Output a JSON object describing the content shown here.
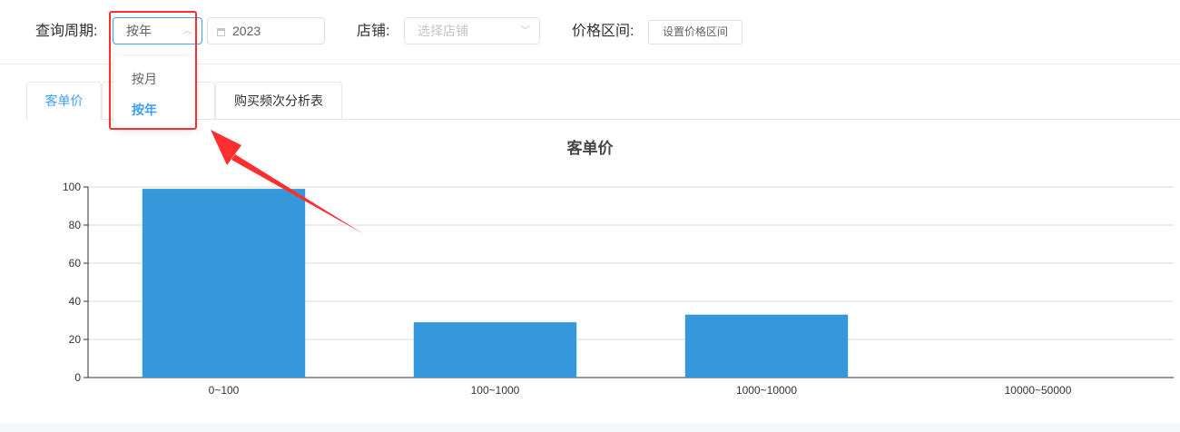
{
  "filter": {
    "period_label": "查询周期:",
    "period_value": "按年",
    "year_value": "2023",
    "shop_label": "店铺:",
    "shop_placeholder": "选择店铺",
    "price_range_label": "价格区间:",
    "price_range_button": "设置价格区间"
  },
  "dropdown": {
    "options": [
      {
        "label": "按月",
        "selected": false
      },
      {
        "label": "按年",
        "selected": true
      }
    ]
  },
  "tabs": [
    {
      "label": "客单价",
      "active": true
    },
    {
      "label": "",
      "active": false
    },
    {
      "label": "购买频次分析表",
      "active": false
    }
  ],
  "colors": {
    "accent": "#409eff",
    "bar": "#3498db",
    "highlight": "#ff2f2f"
  },
  "chart_data": {
    "type": "bar",
    "title": "客单价",
    "categories": [
      "0~100",
      "100~1000",
      "1000~10000",
      "10000~50000"
    ],
    "values": [
      99,
      29,
      33,
      0
    ],
    "ylim": [
      0,
      100
    ],
    "yticks": [
      0,
      20,
      40,
      60,
      80,
      100
    ],
    "grid": true
  }
}
